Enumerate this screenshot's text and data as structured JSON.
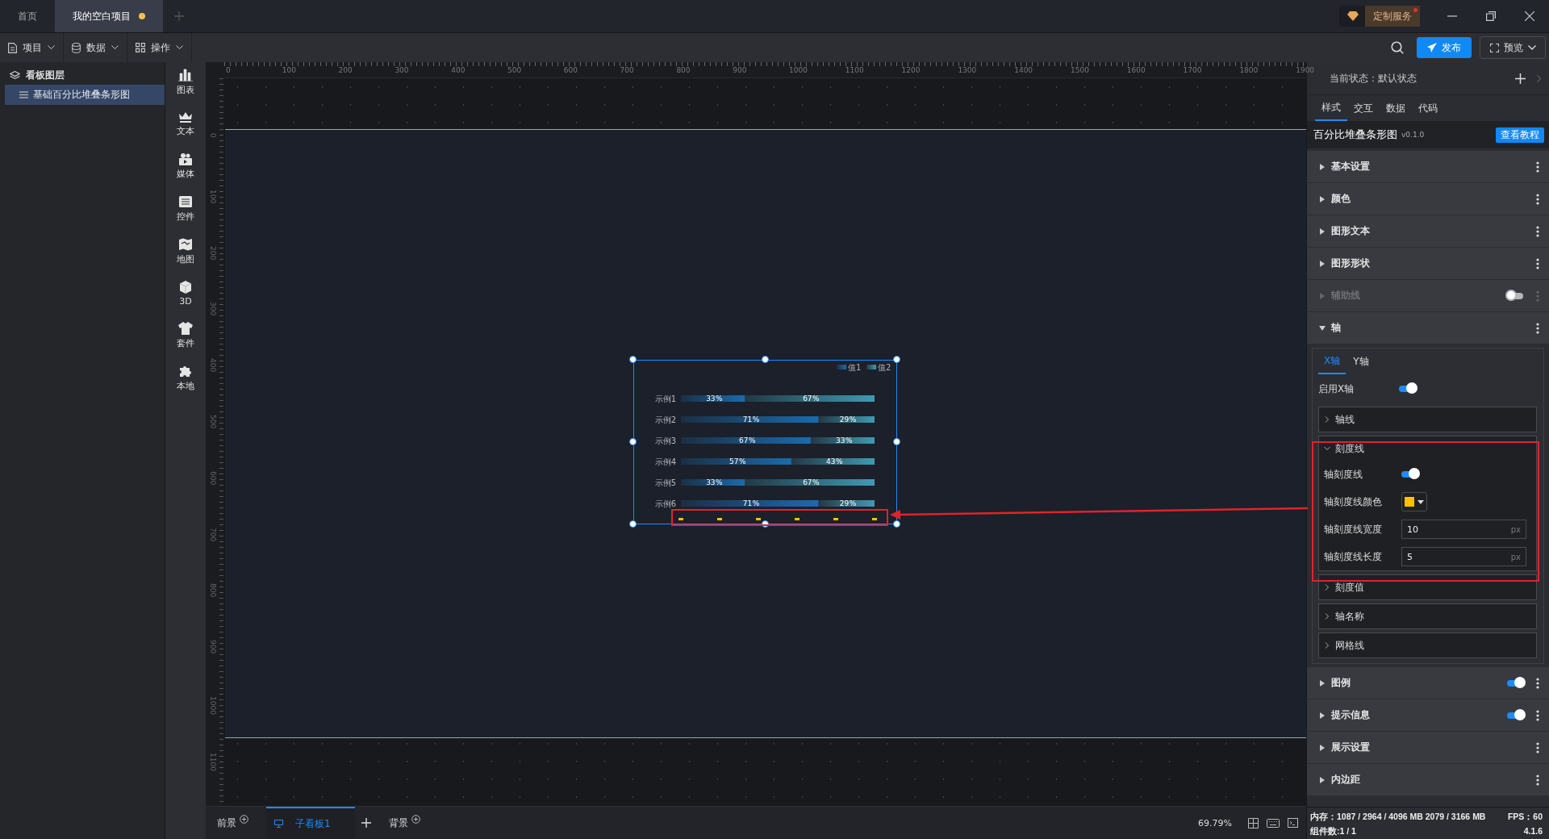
{
  "window_tabs": [
    {
      "label": "首页",
      "selected": false,
      "unsaved": false
    },
    {
      "label": "我的空白项目",
      "selected": true,
      "unsaved": true
    }
  ],
  "service_button": {
    "label": "定制服务",
    "notification": true
  },
  "menus": [
    {
      "label": "项目",
      "kind": "file"
    },
    {
      "label": "数据",
      "kind": "database"
    },
    {
      "label": "操作",
      "kind": "grid"
    }
  ],
  "publish_button": "发布",
  "preview_button": "预览",
  "layers_panel": {
    "title": "看板图层",
    "items": [
      {
        "label": "基础百分比堆叠条形图",
        "selected": true
      }
    ]
  },
  "component_library": [
    {
      "label": "图表",
      "kind": "chart"
    },
    {
      "label": "文本",
      "kind": "text"
    },
    {
      "label": "媒体",
      "kind": "media"
    },
    {
      "label": "控件",
      "kind": "control"
    },
    {
      "label": "地图",
      "kind": "map"
    },
    {
      "label": "3D",
      "kind": "cube"
    },
    {
      "label": "套件",
      "kind": "kit"
    },
    {
      "label": "本地",
      "kind": "local"
    }
  ],
  "rulers": {
    "x_labels": [
      "0",
      "100",
      "200",
      "300",
      "400",
      "500",
      "600",
      "700",
      "800",
      "900",
      "1000",
      "1100",
      "1200",
      "1300",
      "1400",
      "1500",
      "1600",
      "1700",
      "1800",
      "1900"
    ],
    "y_labels": [
      "0",
      "100",
      "200",
      "300",
      "400",
      "500",
      "600",
      "700",
      "800",
      "900",
      "1000",
      "1100"
    ]
  },
  "canvas_widget": {
    "selected": true,
    "chart_data": {
      "type": "bar",
      "orientation": "horizontal",
      "stacked": true,
      "categories": [
        "示例1",
        "示例2",
        "示例3",
        "示例4",
        "示例5",
        "示例6"
      ],
      "series": [
        {
          "name": "值1",
          "color": "#1a84d8",
          "values": [
            33,
            71,
            67,
            57,
            33,
            71
          ]
        },
        {
          "name": "值2",
          "color": "#4cc3df",
          "values": [
            67,
            29,
            33,
            43,
            67,
            29
          ]
        }
      ],
      "legend": true,
      "data_labels": true,
      "value_labels": [
        [
          "33%",
          "71%",
          "67%",
          "57%",
          "33%",
          "71%"
        ],
        [
          "67%",
          "29%",
          "33%",
          "43%",
          "67%",
          "29%"
        ]
      ]
    }
  },
  "bottom_bar": {
    "foreground": "前景",
    "boards": [
      {
        "label": "子看板1",
        "selected": true
      }
    ],
    "background": "背景",
    "zoom": "69.79%"
  },
  "inspector": {
    "state": "当前状态：默认状态",
    "tabs": [
      {
        "label": "样式",
        "selected": true
      },
      {
        "label": "交互",
        "selected": false
      },
      {
        "label": "数据",
        "selected": false
      },
      {
        "label": "代码",
        "selected": false
      }
    ],
    "title": "百分比堆叠条形图",
    "version": "v0.1.0",
    "tutorial_button": "查看教程",
    "sections": [
      {
        "label": "基本设置",
        "kind": "plain",
        "expanded": false,
        "disabled": false
      },
      {
        "label": "颜色",
        "kind": "plain",
        "expanded": false,
        "disabled": false
      },
      {
        "label": "图形文本",
        "kind": "plain",
        "expanded": false,
        "disabled": false
      },
      {
        "label": "图形形状",
        "kind": "plain",
        "expanded": false,
        "disabled": false
      },
      {
        "label": "辅助线",
        "kind": "toggle",
        "on": false,
        "expanded": false,
        "disabled": true
      },
      {
        "label": "轴",
        "kind": "plain",
        "expanded": true,
        "disabled": false,
        "body": {
          "tabs": [
            {
              "label": "X轴",
              "selected": true
            },
            {
              "label": "Y轴",
              "selected": false
            }
          ],
          "enable_label": "启用X轴",
          "enabled": true,
          "groups": [
            {
              "label": "轴线",
              "expanded": false
            },
            {
              "label": "刻度线",
              "expanded": true,
              "fields": [
                {
                  "kind": "toggle",
                  "label": "轴刻度线",
                  "on": true
                },
                {
                  "kind": "color",
                  "label": "轴刻度线颜色",
                  "color": "#ffc000"
                },
                {
                  "kind": "number",
                  "label": "轴刻度线宽度",
                  "value": "10",
                  "unit": "px"
                },
                {
                  "kind": "number",
                  "label": "轴刻度线长度",
                  "value": "5",
                  "unit": "px"
                }
              ]
            },
            {
              "label": "刻度值",
              "expanded": false
            },
            {
              "label": "轴名称",
              "expanded": false
            },
            {
              "label": "网格线",
              "expanded": false
            }
          ]
        }
      },
      {
        "label": "图例",
        "kind": "toggle",
        "on": true,
        "expanded": false,
        "disabled": false
      },
      {
        "label": "提示信息",
        "kind": "toggle",
        "on": true,
        "expanded": false,
        "disabled": false
      },
      {
        "label": "展示设置",
        "kind": "plain",
        "expanded": false,
        "disabled": false
      },
      {
        "label": "内边距",
        "kind": "plain",
        "expanded": false,
        "disabled": false
      }
    ]
  },
  "status": {
    "memory": "内存：1087 / 2964 / 4096 MB  2079 / 3166 MB",
    "fps": "FPS：60",
    "components": "组件数:1 / 1",
    "version": "4.1.6"
  }
}
